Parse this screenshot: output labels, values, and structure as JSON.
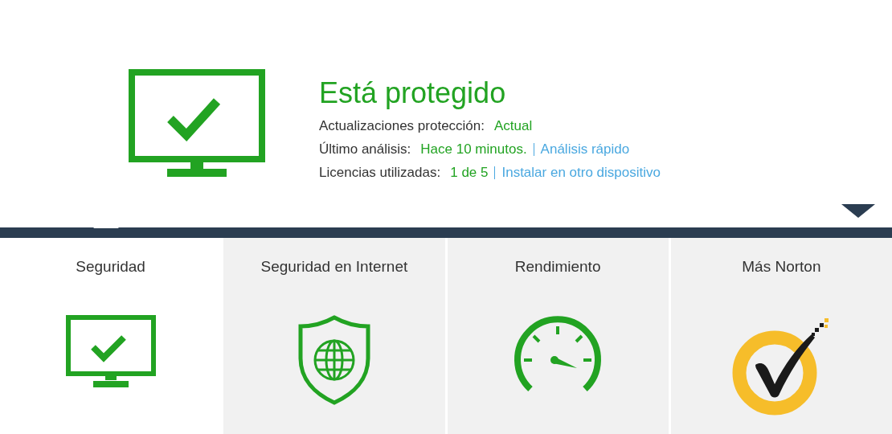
{
  "status": {
    "title": "Está protegido",
    "rows": [
      {
        "label": "Actualizaciones protección:",
        "value": "Actual"
      },
      {
        "label": "Último análisis:",
        "value": "Hace 10 minutos.",
        "link": "Análisis rápido"
      },
      {
        "label": "Licencias utilizadas:",
        "value": "1 de 5",
        "link": "Instalar en otro dispositivo"
      }
    ]
  },
  "tabs": [
    {
      "label": "Seguridad",
      "selected": true,
      "kind": "monitor"
    },
    {
      "label": "Seguridad en Internet",
      "selected": false,
      "kind": "shield"
    },
    {
      "label": "Rendimiento",
      "selected": false,
      "kind": "gauge"
    },
    {
      "label": "Más Norton",
      "selected": false,
      "kind": "badge"
    }
  ]
}
